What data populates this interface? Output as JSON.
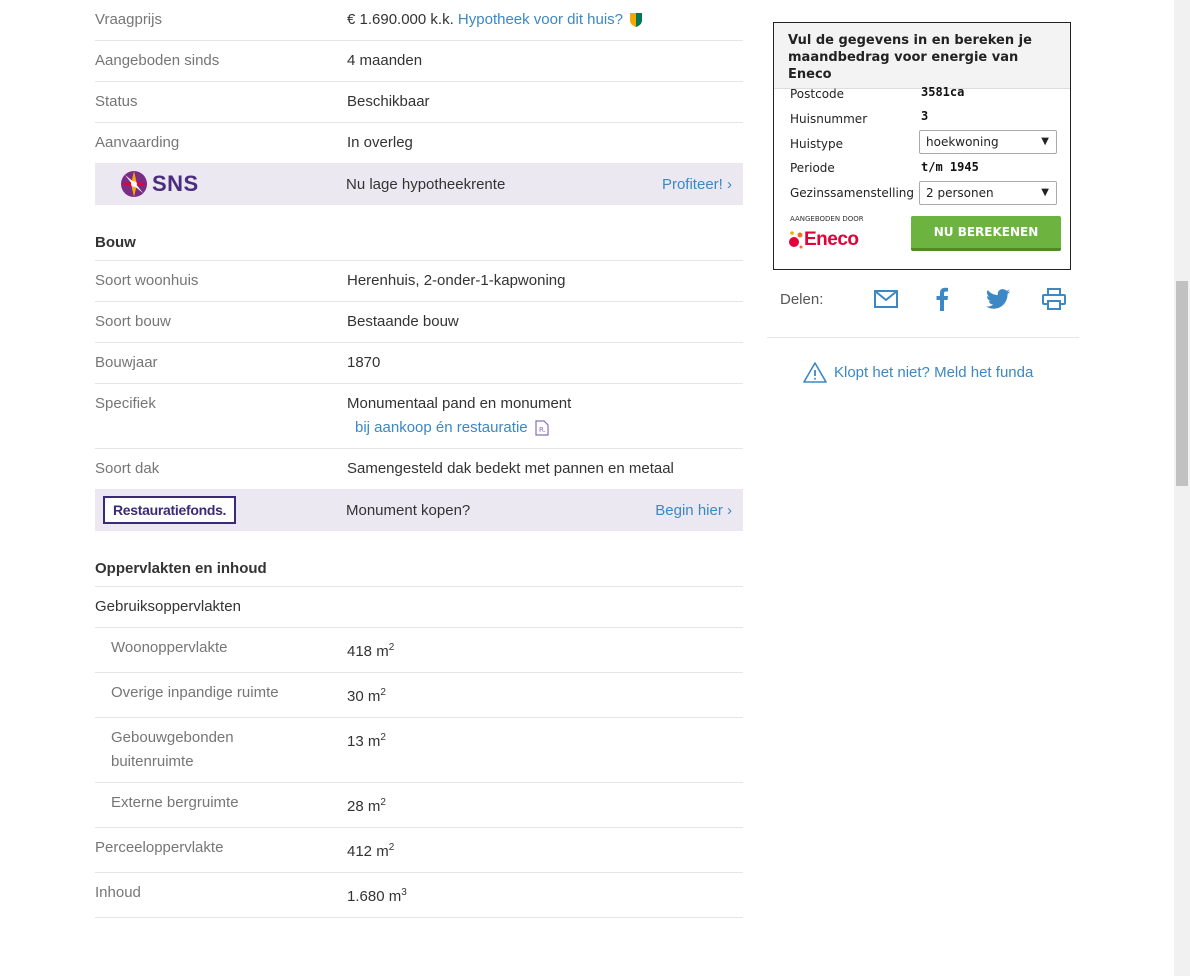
{
  "overview": {
    "price_label": "Vraagprijs",
    "price_value": "€ 1.690.000 k.k.",
    "mortgage_link": "Hypotheek voor dit huis?",
    "since_label": "Aangeboden sinds",
    "since_value": "4 maanden",
    "status_label": "Status",
    "status_value": "Beschikbaar",
    "acceptance_label": "Aanvaarding",
    "acceptance_value": "In overleg"
  },
  "promo_sns": {
    "logo": "SNS",
    "text": "Nu lage hypotheekrente",
    "cta": "Profiteer! ›"
  },
  "bouw": {
    "title": "Bouw",
    "rows": [
      {
        "label": "Soort woonhuis",
        "value": "Herenhuis, 2-onder-1-kapwoning"
      },
      {
        "label": "Soort bouw",
        "value": "Bestaande bouw"
      },
      {
        "label": "Bouwjaar",
        "value": "1870"
      }
    ],
    "specifiek_label": "Specifiek",
    "specifiek_value": "Monumentaal pand en monument",
    "specifiek_link": "bij aankoop én restauratie",
    "dak_label": "Soort dak",
    "dak_value": "Samengesteld dak bedekt met pannen en metaal"
  },
  "promo_rest": {
    "logo": "Restauratiefonds.",
    "text": "Monument kopen?",
    "cta": "Begin hier ›"
  },
  "opp": {
    "title": "Oppervlakten en inhoud",
    "group": "Gebruiksoppervlakten",
    "woon_label": "Woonoppervlakte",
    "woon_value": "418 m",
    "overig_label": "Overige inpandige ruimte",
    "overig_value": "30 m",
    "gebouw_label1": "Gebouwgebonden",
    "gebouw_label2": "buitenruimte",
    "gebouw_value": "13 m",
    "extern_label": "Externe bergruimte",
    "extern_value": "28 m",
    "perceel_label": "Perceeloppervlakte",
    "perceel_value": "412 m",
    "inhoud_label": "Inhoud",
    "inhoud_value": "1.680 m",
    "sq": "2",
    "cube": "3"
  },
  "widget": {
    "heading": "Vul de gegevens in en bereken je maandbedrag voor energie van Eneco",
    "postcode_label": "Postcode",
    "postcode_value": "3581ca",
    "huisnummer_label": "Huisnummer",
    "huisnummer_value": "3",
    "huistype_label": "Huistype",
    "huistype_value": "hoekwoning",
    "periode_label": "Periode",
    "periode_value": "t/m 1945",
    "gezin_label": "Gezinssamenstelling",
    "gezin_value": "2 personen",
    "offered_by": "AANGEBODEN DOOR",
    "brand": "Eneco",
    "button": "NU BEREKENEN"
  },
  "share": {
    "label": "Delen:",
    "icons": [
      "mail-icon",
      "facebook-icon",
      "twitter-icon",
      "print-icon"
    ]
  },
  "report": {
    "text": "Klopt het niet? Meld het funda"
  },
  "colors": {
    "link": "#3b88c4",
    "promo_bg": "#ebe8f2",
    "button_green": "#6db33f",
    "eneco_red": "#e4003a"
  }
}
